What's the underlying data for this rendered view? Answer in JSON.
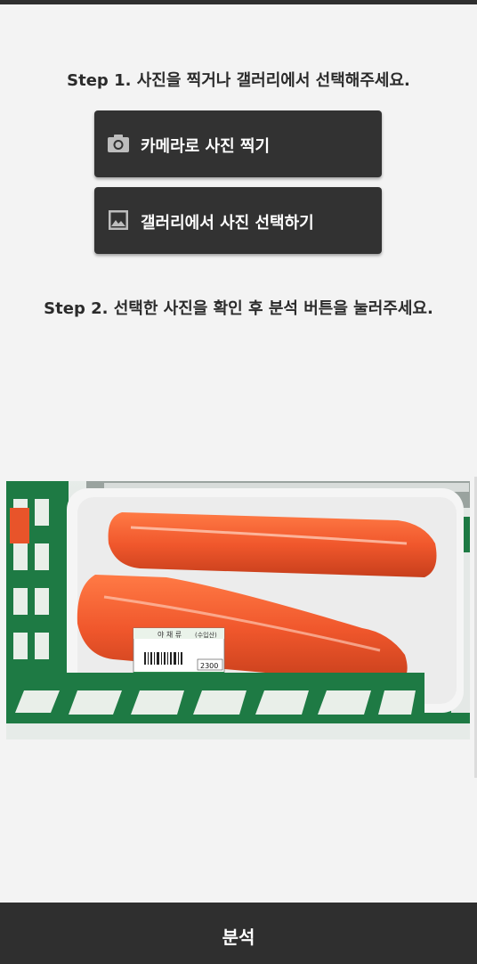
{
  "steps": {
    "step1": "Step 1. 사진을 찍거나 갤러리에서 선택해주세요.",
    "step2": "Step 2. 선택한 사진을 확인 후 분석 버튼을 눌러주세요."
  },
  "buttons": {
    "camera": {
      "label": "카메라로 사진 찍기",
      "icon": "camera-icon"
    },
    "gallery": {
      "label": "갤러리에서 사진 선택하기",
      "icon": "image-icon"
    },
    "analyze": {
      "label": "분석"
    }
  },
  "photo": {
    "label_text": "야 채 류",
    "origin_text": "(수입산)",
    "price_text": "2300"
  },
  "colors": {
    "button_bg": "#323232",
    "background": "#f3f3f3",
    "carrot": "#f0572c",
    "crate_green": "#1e7a44"
  }
}
